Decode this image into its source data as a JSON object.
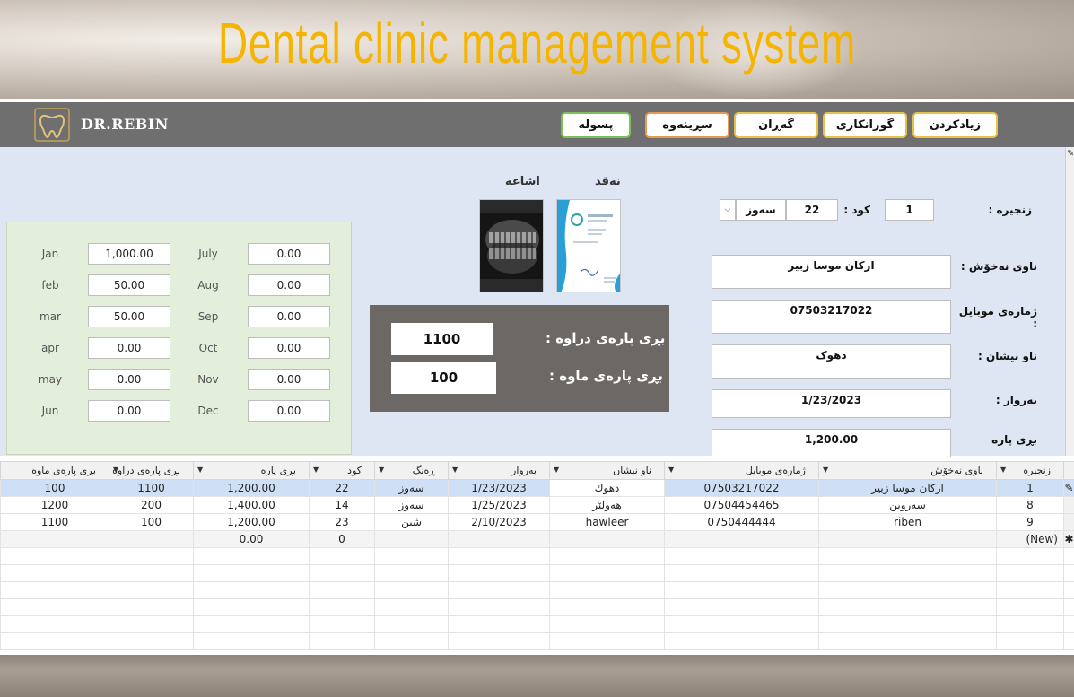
{
  "headline": "Dental clinic management system",
  "brand": "DR.REBIN",
  "nav": {
    "add": "زیادکردن",
    "edit": "گورانکاری",
    "search": "گەڕان",
    "delete": "سڕینەوە",
    "receipt": "پسولە"
  },
  "images": {
    "cash_label": "نەقد",
    "xray_label": "اشاعە"
  },
  "months": [
    {
      "name": "Jan",
      "value": "1,000.00"
    },
    {
      "name": "feb",
      "value": "50.00"
    },
    {
      "name": "mar",
      "value": "50.00"
    },
    {
      "name": "apr",
      "value": "0.00"
    },
    {
      "name": "may",
      "value": "0.00"
    },
    {
      "name": "Jun",
      "value": "0.00"
    },
    {
      "name": "July",
      "value": "0.00"
    },
    {
      "name": "Aug",
      "value": "0.00"
    },
    {
      "name": "Sep",
      "value": "0.00"
    },
    {
      "name": "Oct",
      "value": "0.00"
    },
    {
      "name": "Nov",
      "value": "0.00"
    },
    {
      "name": "Dec",
      "value": "0.00"
    }
  ],
  "totals": {
    "paid_label": "بڕی پارەی دراوە :",
    "paid_value": "1100",
    "remaining_label": "بڕی پارەی ماوە :",
    "remaining_value": "100"
  },
  "form": {
    "serial_label": "زنجیرە :",
    "serial_value": "1",
    "code_label": "کود :",
    "code_value": "22",
    "color_value": "سەوز",
    "name_label": "ناوی نەخۆش :",
    "name_value": "ارکان موسا زبیر",
    "mobile_label": "ژمارەی موبایل :",
    "mobile_value": "07503217022",
    "address_label": "ناو نیشان :",
    "address_value": "دهوک",
    "date_label": "بەروار :",
    "date_value": "1/23/2023",
    "amount_label": "بڕی پارە",
    "amount_value": "1,200.00"
  },
  "table": {
    "headers": {
      "remaining": "بڕی پارەی ماوە",
      "paid": "بڕی پارەی دراوە",
      "amount": "بڕی پارە",
      "code": "کود",
      "color": "ڕەنگ",
      "date": "بەروار",
      "address": "ناو نیشان",
      "mobile": "ژمارەی موبایل",
      "name": "ناوی نەخۆش",
      "serial": "زنجیرە"
    },
    "rows": [
      {
        "remaining": "100",
        "paid": "1100",
        "amount": "1,200.00",
        "code": "22",
        "color": "سەوز",
        "date": "1/23/2023",
        "address": "دهوك",
        "mobile": "07503217022",
        "name": "ارکان موسا زبیر",
        "serial": "1"
      },
      {
        "remaining": "1200",
        "paid": "200",
        "amount": "1,400.00",
        "code": "14",
        "color": "سەوز",
        "date": "1/25/2023",
        "address": "هەولێر",
        "mobile": "07504454465",
        "name": "سەروین",
        "serial": "8"
      },
      {
        "remaining": "1100",
        "paid": "100",
        "amount": "1,200.00",
        "code": "23",
        "color": "شین",
        "date": "2/10/2023",
        "address": "hawleer",
        "mobile": "0750444444",
        "name": "riben",
        "serial": "9"
      }
    ],
    "new_row": {
      "amount": "0.00",
      "code": "0",
      "serial": "(New)"
    }
  },
  "colors": {
    "headline": "#f5b400",
    "topbar": "#6f6f6f",
    "form_bg": "#dde6f2",
    "months_bg": "#e4efdb",
    "totals_bg": "#6c6866",
    "selected_row": "#cfe0f6"
  },
  "icons": {
    "logo": "tooth-logo-icon",
    "dropdown": "chevron-down-icon",
    "record_selector": "pencil-icon",
    "new_record": "asterisk-icon"
  }
}
